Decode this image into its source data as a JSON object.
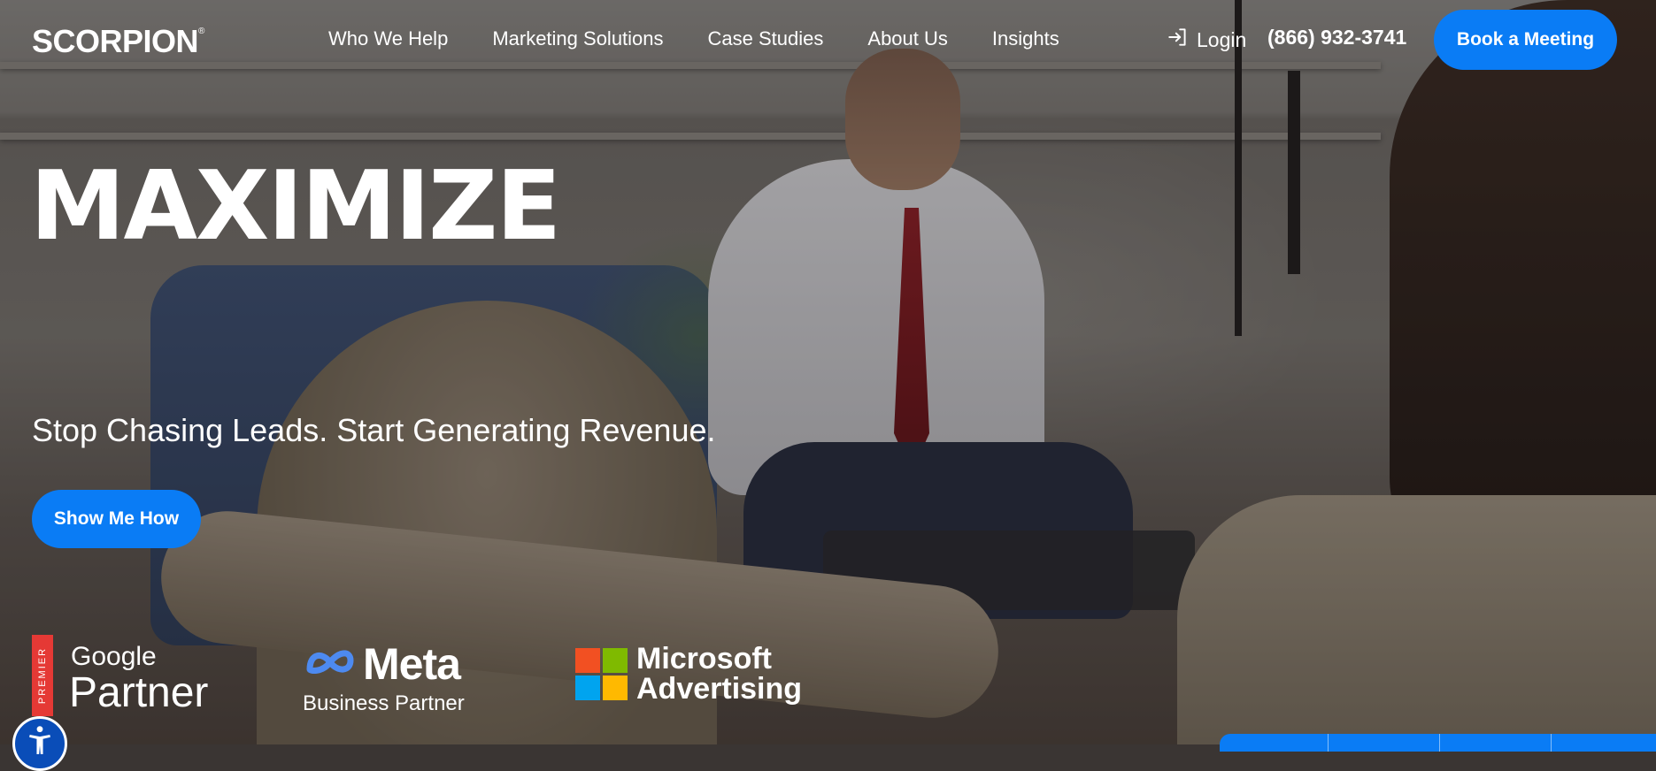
{
  "brand": {
    "logo_text": "SCORPION",
    "logo_mark": "®"
  },
  "nav": {
    "items": [
      {
        "label": "Who We Help"
      },
      {
        "label": "Marketing Solutions"
      },
      {
        "label": "Case Studies"
      },
      {
        "label": "About Us"
      },
      {
        "label": "Insights"
      }
    ]
  },
  "header": {
    "login_label": "Login",
    "login_icon": "login-icon",
    "phone": "(866) 932-3741",
    "cta_label": "Book a Meeting"
  },
  "hero": {
    "headline": "MAXIMIZE",
    "subheadline": "Stop Chasing Leads. Start Generating Revenue.",
    "cta_label": "Show Me How"
  },
  "partners": {
    "google": {
      "tag": "PREMIER",
      "line1": "Google",
      "line2": "Partner"
    },
    "meta": {
      "name": "Meta",
      "subtitle": "Business Partner"
    },
    "microsoft": {
      "line1": "Microsoft",
      "line2": "Advertising"
    }
  },
  "colors": {
    "accent": "#0a7cf5",
    "google_red": "#e53935",
    "meta_blue": "#4d8af0",
    "ms_red": "#f25022",
    "ms_green": "#7fba00",
    "ms_blue": "#00a4ef",
    "ms_yellow": "#ffb900"
  },
  "accessibility": {
    "icon": "accessibility-icon"
  }
}
